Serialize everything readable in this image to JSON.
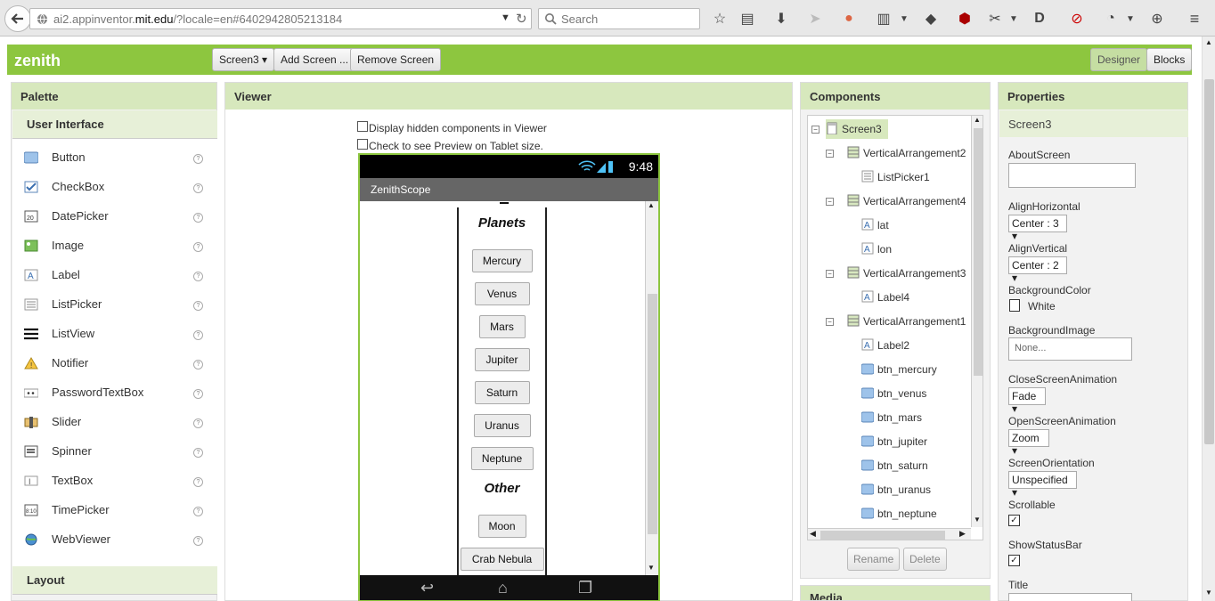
{
  "browser": {
    "url_prefix": "ai2.appinventor.",
    "url_domain": "mit.edu",
    "url_suffix": "/?locale=en#6402942805213184",
    "search_placeholder": "Search"
  },
  "header": {
    "project_name": "zenith",
    "screen_select": "Screen3 ▾",
    "add_screen": "Add Screen ...",
    "remove_screen": "Remove Screen",
    "designer": "Designer",
    "blocks": "Blocks"
  },
  "palette": {
    "title": "Palette",
    "category": "User Interface",
    "items": [
      {
        "label": "Button",
        "icon": "button-icon"
      },
      {
        "label": "CheckBox",
        "icon": "checkbox-icon"
      },
      {
        "label": "DatePicker",
        "icon": "datepicker-icon"
      },
      {
        "label": "Image",
        "icon": "image-icon"
      },
      {
        "label": "Label",
        "icon": "label-icon"
      },
      {
        "label": "ListPicker",
        "icon": "listpicker-icon"
      },
      {
        "label": "ListView",
        "icon": "listview-icon"
      },
      {
        "label": "Notifier",
        "icon": "notifier-icon"
      },
      {
        "label": "PasswordTextBox",
        "icon": "passwordtextbox-icon"
      },
      {
        "label": "Slider",
        "icon": "slider-icon"
      },
      {
        "label": "Spinner",
        "icon": "spinner-icon"
      },
      {
        "label": "TextBox",
        "icon": "textbox-icon"
      },
      {
        "label": "TimePicker",
        "icon": "timepicker-icon"
      },
      {
        "label": "WebViewer",
        "icon": "webviewer-icon"
      }
    ],
    "help": "?",
    "next_category": "Layout"
  },
  "viewer": {
    "title": "Viewer",
    "hidden_components_label": "Display hidden components in Viewer",
    "tablet_preview_label": "Check to see Preview on Tablet size.",
    "phone": {
      "time": "9:48",
      "app_title": "ZenithScope",
      "planets_header": "Planets",
      "planets": [
        "Mercury",
        "Venus",
        "Mars",
        "Jupiter",
        "Saturn",
        "Uranus",
        "Neptune"
      ],
      "other_header": "Other",
      "other": [
        "Moon",
        "Crab Nebula"
      ]
    }
  },
  "components": {
    "title": "Components",
    "tree": [
      {
        "label": "Screen3",
        "depth": 0,
        "kind": "screen",
        "toggle": "⊟"
      },
      {
        "label": "VerticalArrangement2",
        "depth": 1,
        "kind": "arrangement",
        "toggle": "⊟"
      },
      {
        "label": "ListPicker1",
        "depth": 2,
        "kind": "listpicker"
      },
      {
        "label": "VerticalArrangement4",
        "depth": 1,
        "kind": "arrangement",
        "toggle": "⊟"
      },
      {
        "label": "lat",
        "depth": 2,
        "kind": "label"
      },
      {
        "label": "lon",
        "depth": 2,
        "kind": "label"
      },
      {
        "label": "VerticalArrangement3",
        "depth": 1,
        "kind": "arrangement",
        "toggle": "⊟"
      },
      {
        "label": "Label4",
        "depth": 2,
        "kind": "label"
      },
      {
        "label": "VerticalArrangement1",
        "depth": 1,
        "kind": "arrangement",
        "toggle": "⊟"
      },
      {
        "label": "Label2",
        "depth": 2,
        "kind": "label"
      },
      {
        "label": "btn_mercury",
        "depth": 2,
        "kind": "button"
      },
      {
        "label": "btn_venus",
        "depth": 2,
        "kind": "button"
      },
      {
        "label": "btn_mars",
        "depth": 2,
        "kind": "button"
      },
      {
        "label": "btn_jupiter",
        "depth": 2,
        "kind": "button"
      },
      {
        "label": "btn_saturn",
        "depth": 2,
        "kind": "button"
      },
      {
        "label": "btn_uranus",
        "depth": 2,
        "kind": "button"
      },
      {
        "label": "btn_neptune",
        "depth": 2,
        "kind": "button"
      }
    ],
    "rename": "Rename",
    "delete": "Delete",
    "next_section": "Media"
  },
  "properties": {
    "title": "Properties",
    "screen": "Screen3",
    "about_screen": "AboutScreen",
    "align_horizontal": "AlignHorizontal",
    "align_horizontal_value": "Center : 3 ▾",
    "align_vertical": "AlignVertical",
    "align_vertical_value": "Center : 2 ▾",
    "background_color": "BackgroundColor",
    "background_color_value": "White",
    "background_image": "BackgroundImage",
    "background_image_value": "None...",
    "close_animation": "CloseScreenAnimation",
    "close_animation_value": "Fade ▾",
    "open_animation": "OpenScreenAnimation",
    "open_animation_value": "Zoom ▾",
    "orientation": "ScreenOrientation",
    "orientation_value": "Unspecified ▾",
    "scrollable": "Scrollable",
    "scrollable_check": "✓",
    "show_status_bar": "ShowStatusBar",
    "show_status_bar_check": "✓",
    "title_prop": "Title"
  },
  "colors": {
    "accent": "#8dc63f",
    "panel_header": "#d7e8bd"
  }
}
